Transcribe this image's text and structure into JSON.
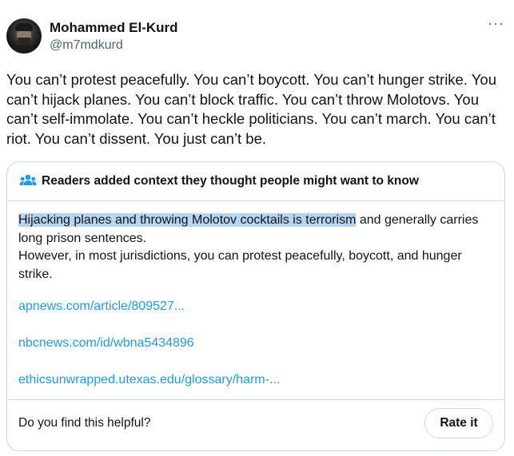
{
  "author": {
    "name": "Mohammed El-Kurd",
    "handle": "@m7mdkurd"
  },
  "menu_glyph": "···",
  "tweet": {
    "text": "You can’t protest peacefully. You can’t boycott. You can’t hunger strike. You can’t hijack planes. You can’t block traffic. You can’t throw Molotovs. You can’t self-immolate. You can’t heckle politicians. You can’t march. You can’t riot. You can’t dissent. You just can’t be."
  },
  "community_note": {
    "icon": "people-icon",
    "title": "Readers added context they thought people might want to know",
    "highlighted_text": "Hijacking planes and throwing Molotov cocktails is terrorism",
    "text_rest": " and generally carries long prison sentences.",
    "text_line2": "However, in most jurisdictions, you can protest peacefully, boycott, and hunger strike.",
    "links": [
      "apnews.com/article/809527...",
      "nbcnews.com/id/wbna5434896",
      "ethicsunwrapped.utexas.edu/glossary/harm-..."
    ],
    "footer_question": "Do you find this helpful?",
    "rate_button": "Rate it"
  },
  "colors": {
    "link": "#1d9bf0",
    "highlight": "#b8d4f3",
    "border": "#cfd9de",
    "secondary_text": "#536471"
  }
}
